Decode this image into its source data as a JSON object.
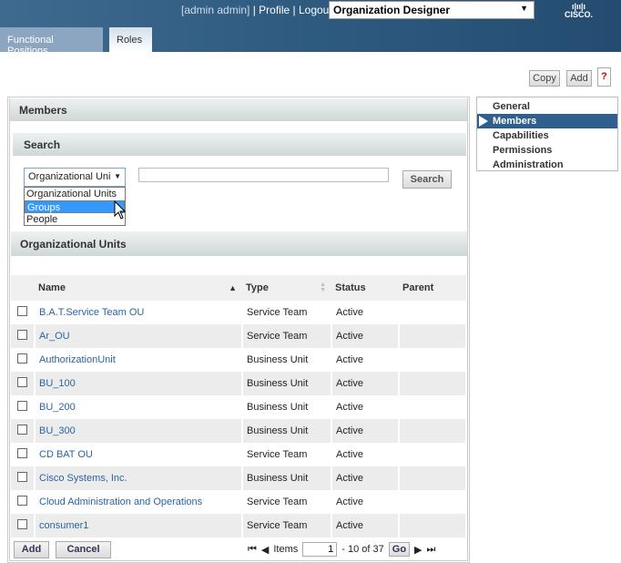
{
  "header": {
    "user": "[admin admin]",
    "profile": "Profile",
    "logout": "Logout",
    "app_select": "Organization Designer",
    "logo": "cisco"
  },
  "tabs": [
    {
      "label": "Functional Positions",
      "active": false
    },
    {
      "label": "Roles",
      "active": true
    }
  ],
  "toolbar": {
    "copy": "Copy",
    "add": "Add",
    "help": "?"
  },
  "panel": {
    "title": "Members"
  },
  "search": {
    "title": "Search",
    "type_select": "Organizational Uni",
    "options": [
      "Organizational Units",
      "Groups",
      "People"
    ],
    "highlighted": "Groups",
    "query": "",
    "button": "Search"
  },
  "results": {
    "title": "Organizational Units",
    "columns": [
      "Name",
      "Type",
      "Status",
      "Parent"
    ],
    "rows": [
      {
        "name": "B.A.T.Service Team OU",
        "type": "Service Team",
        "status": "Active",
        "parent": ""
      },
      {
        "name": "Ar_OU",
        "type": "Service Team",
        "status": "Active",
        "parent": ""
      },
      {
        "name": "AuthorizationUnit",
        "type": "Business Unit",
        "status": "Active",
        "parent": ""
      },
      {
        "name": "BU_100",
        "type": "Business Unit",
        "status": "Active",
        "parent": ""
      },
      {
        "name": "BU_200",
        "type": "Business Unit",
        "status": "Active",
        "parent": ""
      },
      {
        "name": "BU_300",
        "type": "Business Unit",
        "status": "Active",
        "parent": ""
      },
      {
        "name": "CD BAT OU",
        "type": "Service Team",
        "status": "Active",
        "parent": ""
      },
      {
        "name": "Cisco Systems, Inc.",
        "type": "Business Unit",
        "status": "Active",
        "parent": ""
      },
      {
        "name": "Cloud Administration and Operations",
        "type": "Service Team",
        "status": "Active",
        "parent": ""
      },
      {
        "name": "consumer1",
        "type": "Service Team",
        "status": "Active",
        "parent": ""
      }
    ]
  },
  "footer": {
    "add": "Add",
    "cancel": "Cancel",
    "items_label": "Items",
    "page_start": "1",
    "range": "- 10  of 37",
    "go": "Go"
  },
  "nav": {
    "items": [
      "General",
      "Members",
      "Capabilities",
      "Permissions",
      "Administration"
    ],
    "selected": "Members"
  }
}
